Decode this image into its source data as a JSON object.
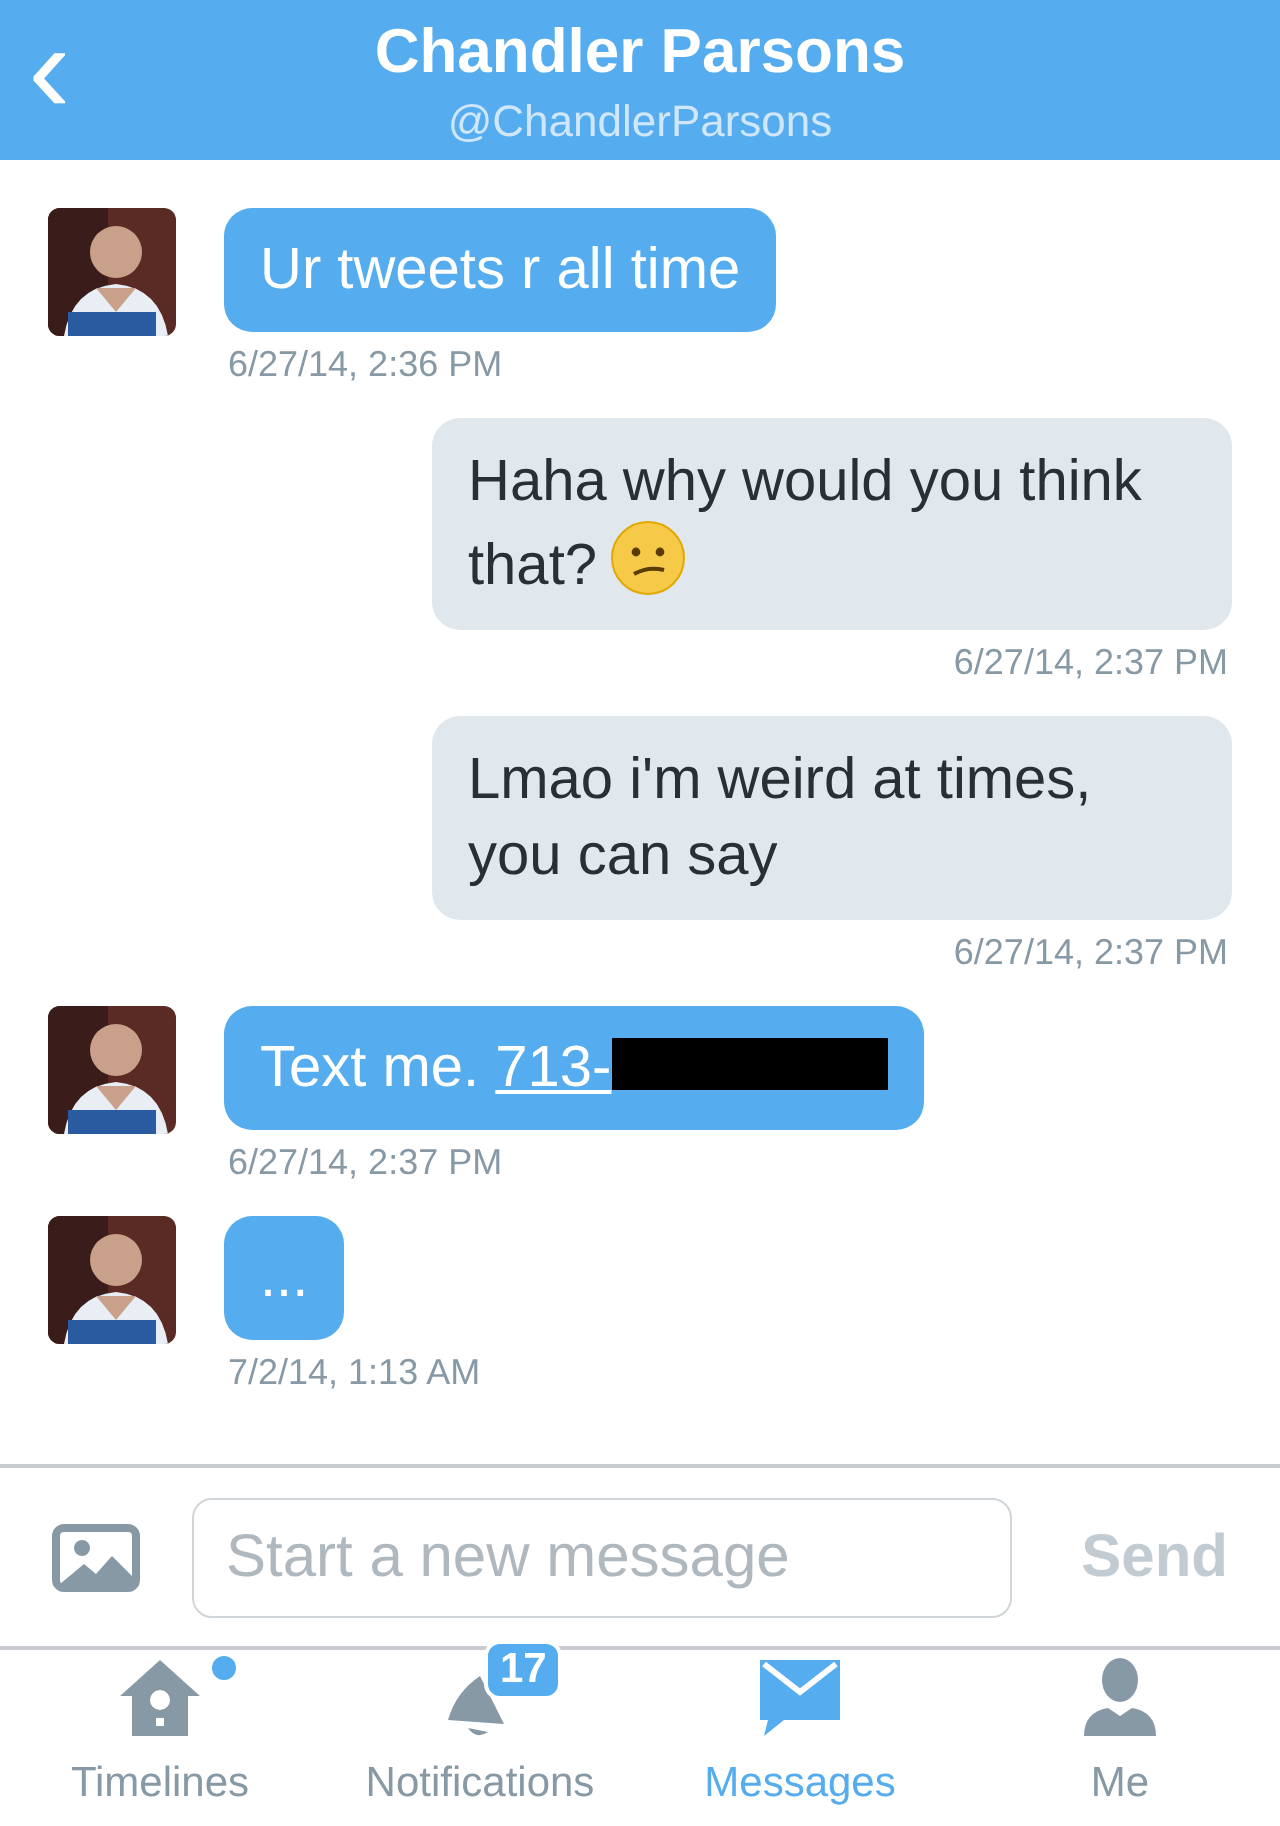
{
  "header": {
    "back": "‹",
    "title": "Chandler Parsons",
    "subtitle": "@ChandlerParsons"
  },
  "messages": [
    {
      "kind": "incoming",
      "text": "Ur tweets r all time",
      "time": "6/27/14, 2:36 PM"
    },
    {
      "kind": "outgoing",
      "text": "Haha why would you think that?",
      "emoji": true,
      "time": "6/27/14, 2:37 PM"
    },
    {
      "kind": "outgoing",
      "text": "Lmao i'm weird at times, you can say",
      "time": "6/27/14, 2:37 PM"
    },
    {
      "kind": "incoming",
      "text": "Text me.",
      "link": "713-",
      "redacted": true,
      "time": "6/27/14, 2:37 PM"
    },
    {
      "kind": "incoming",
      "text": "...",
      "time": "7/2/14, 1:13 AM"
    }
  ],
  "composer": {
    "placeholder": "Start a new message",
    "send": "Send",
    "send_disabled": true
  },
  "tabs": [
    {
      "kind": "home",
      "label": "Timelines",
      "selected": false,
      "dot": true
    },
    {
      "kind": "bell",
      "label": "Notifications",
      "selected": false,
      "badge": "17"
    },
    {
      "kind": "mail",
      "label": "Messages",
      "selected": true
    },
    {
      "kind": "person",
      "label": "Me",
      "selected": false
    }
  ]
}
